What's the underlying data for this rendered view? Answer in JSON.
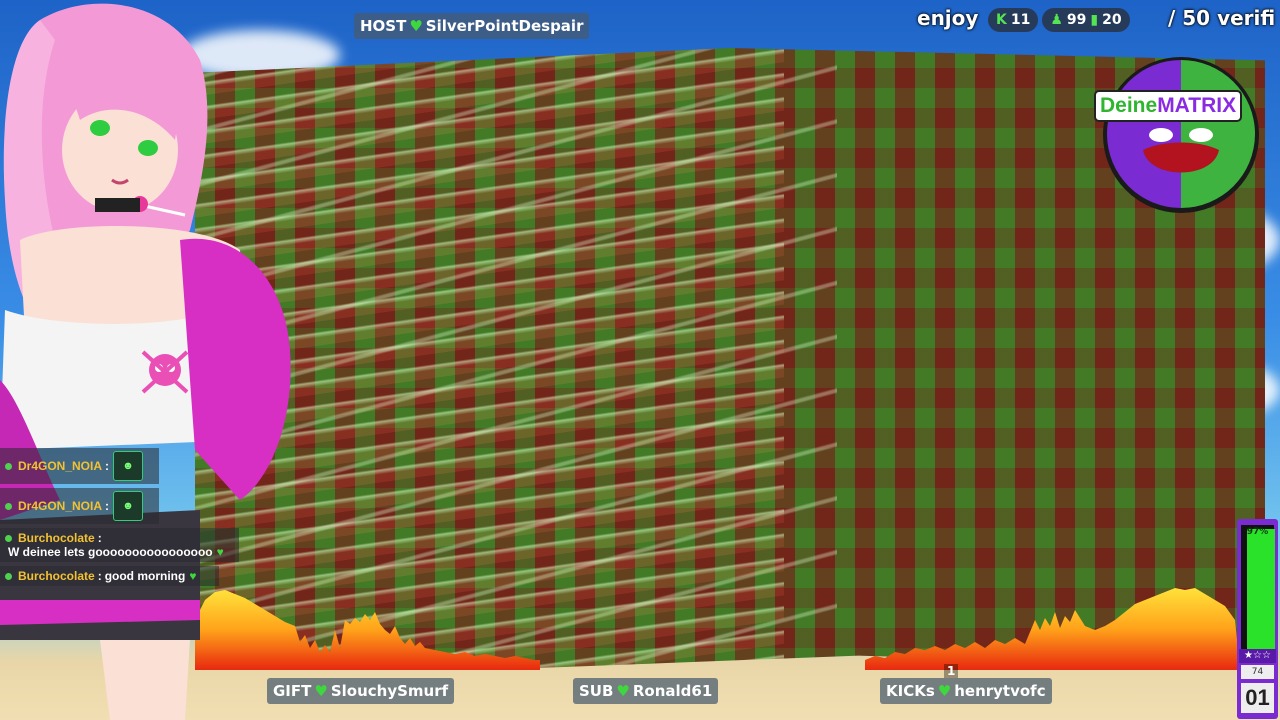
{
  "top": {
    "host_label": "HOST",
    "host_user": "SilverPointDespair",
    "enjoy": "enjoy",
    "stats": [
      {
        "icon": "kick-icon",
        "value": "11"
      },
      {
        "icon": "person-icon",
        "value": "99"
      },
      {
        "icon": "bars-icon",
        "value": "20"
      }
    ],
    "verify_text": "/ 50 verifi"
  },
  "logo": {
    "part_a": "Deine",
    "part_b": "MATRIX"
  },
  "chat": [
    {
      "user": "Dr4GON_NOIA",
      "text": "",
      "has_avatar": true
    },
    {
      "user": "Dr4GON_NOIA",
      "text": "",
      "has_avatar": true
    },
    {
      "user": "Burchocolate",
      "text": "W deinee lets goooooooooooooooo",
      "has_avatar": false
    },
    {
      "user": "Burchocolate",
      "text": "good morning",
      "has_avatar": false
    }
  ],
  "bottom": {
    "gift_label": "GIFT",
    "gift_user": "SlouchySmurf",
    "sub_label": "SUB",
    "sub_user": "Ronald61",
    "kicks_label": "KICKs",
    "kicks_user": "henrytvofc",
    "kick_count": "1"
  },
  "meter": {
    "percent_text": "97%",
    "percent": 97,
    "stars": "★☆☆",
    "count": "74",
    "level": "01"
  },
  "colors": {
    "accent_green": "#3ed83e",
    "meter_purple": "#7a2bd1",
    "username_gold": "#f2c232"
  }
}
